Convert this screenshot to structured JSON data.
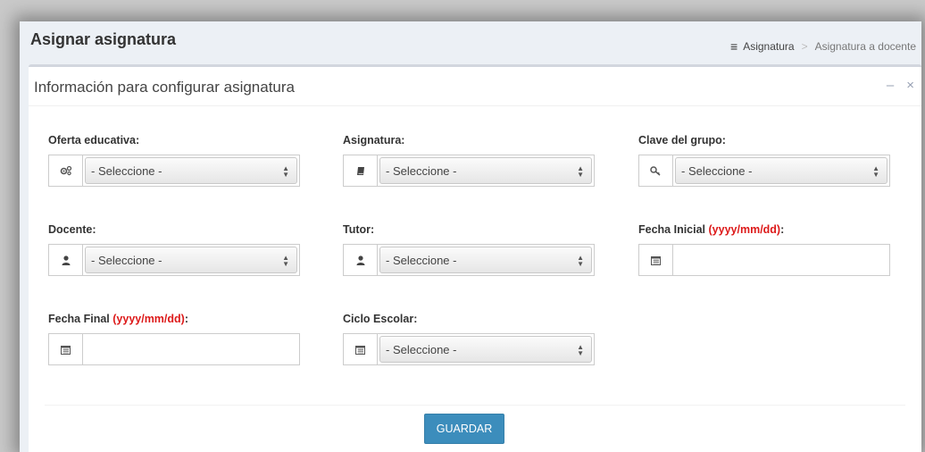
{
  "header": {
    "title": "Asignar asignatura",
    "breadcrumb": {
      "icon": "bars-icon",
      "item1": "Asignatura",
      "item2": "Asignatura a docente"
    }
  },
  "box": {
    "title": "Información para configurar asignatura",
    "minimize": "–",
    "close": "×"
  },
  "form": {
    "oferta": {
      "label": "Oferta educativa:",
      "value": "- Seleccione -",
      "icon": "gears-icon"
    },
    "asignatura": {
      "label": "Asignatura:",
      "value": "- Seleccione -",
      "icon": "book-icon"
    },
    "clave": {
      "label": "Clave del grupo:",
      "value": "- Seleccione -",
      "icon": "key-icon"
    },
    "docente": {
      "label": "Docente:",
      "value": "- Seleccione -",
      "icon": "user-icon"
    },
    "tutor": {
      "label": "Tutor:",
      "value": "- Seleccione -",
      "icon": "user-icon"
    },
    "fecha_inicial": {
      "label": "Fecha Inicial ",
      "hint": "(yyyy/mm/dd)",
      "suffix": ":",
      "value": "",
      "icon": "calendar-icon"
    },
    "fecha_final": {
      "label": "Fecha Final ",
      "hint": "(yyyy/mm/dd)",
      "suffix": ":",
      "value": "",
      "icon": "calendar-icon"
    },
    "ciclo": {
      "label": "Ciclo Escolar:",
      "value": "- Seleccione -",
      "icon": "calendar-icon"
    }
  },
  "save_label": "GUARDAR",
  "colors": {
    "accent": "#3c8dbc",
    "hint": "#dd1a1a"
  }
}
